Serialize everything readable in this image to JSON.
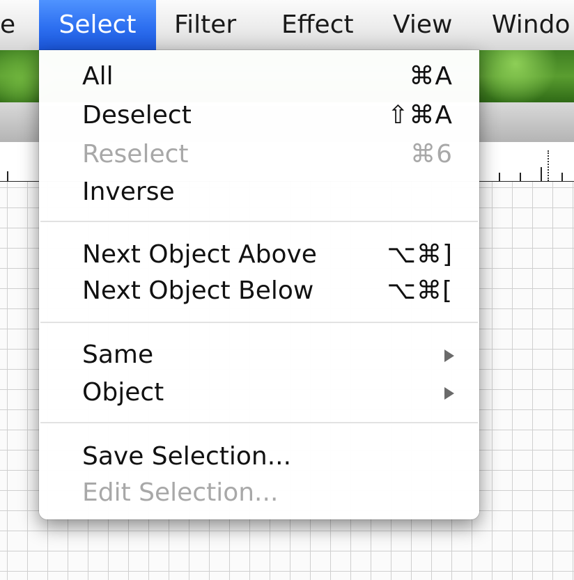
{
  "menubar": {
    "items": [
      {
        "label": "e"
      },
      {
        "label": "Select"
      },
      {
        "label": "Filter"
      },
      {
        "label": "Effect"
      },
      {
        "label": "View"
      },
      {
        "label": "Windo"
      }
    ],
    "active_color": "#2d6ff0"
  },
  "select_menu": {
    "items": [
      {
        "label": "All",
        "shortcut": "⌘A",
        "enabled": true
      },
      {
        "label": "Deselect",
        "shortcut": "⇧⌘A",
        "enabled": true
      },
      {
        "label": "Reselect",
        "shortcut": "⌘6",
        "enabled": false
      },
      {
        "label": "Inverse",
        "shortcut": "",
        "enabled": true
      },
      {
        "label": "Next Object Above",
        "shortcut": "⌥⌘]",
        "enabled": true
      },
      {
        "label": "Next Object Below",
        "shortcut": "⌥⌘[",
        "enabled": true
      },
      {
        "label": "Same",
        "submenu_icon": "triangle-right-icon",
        "enabled": true
      },
      {
        "label": "Object",
        "submenu_icon": "triangle-right-icon",
        "enabled": true
      },
      {
        "label": "Save Selection...",
        "enabled": true
      },
      {
        "label": "Edit Selection...",
        "enabled": false
      }
    ]
  }
}
